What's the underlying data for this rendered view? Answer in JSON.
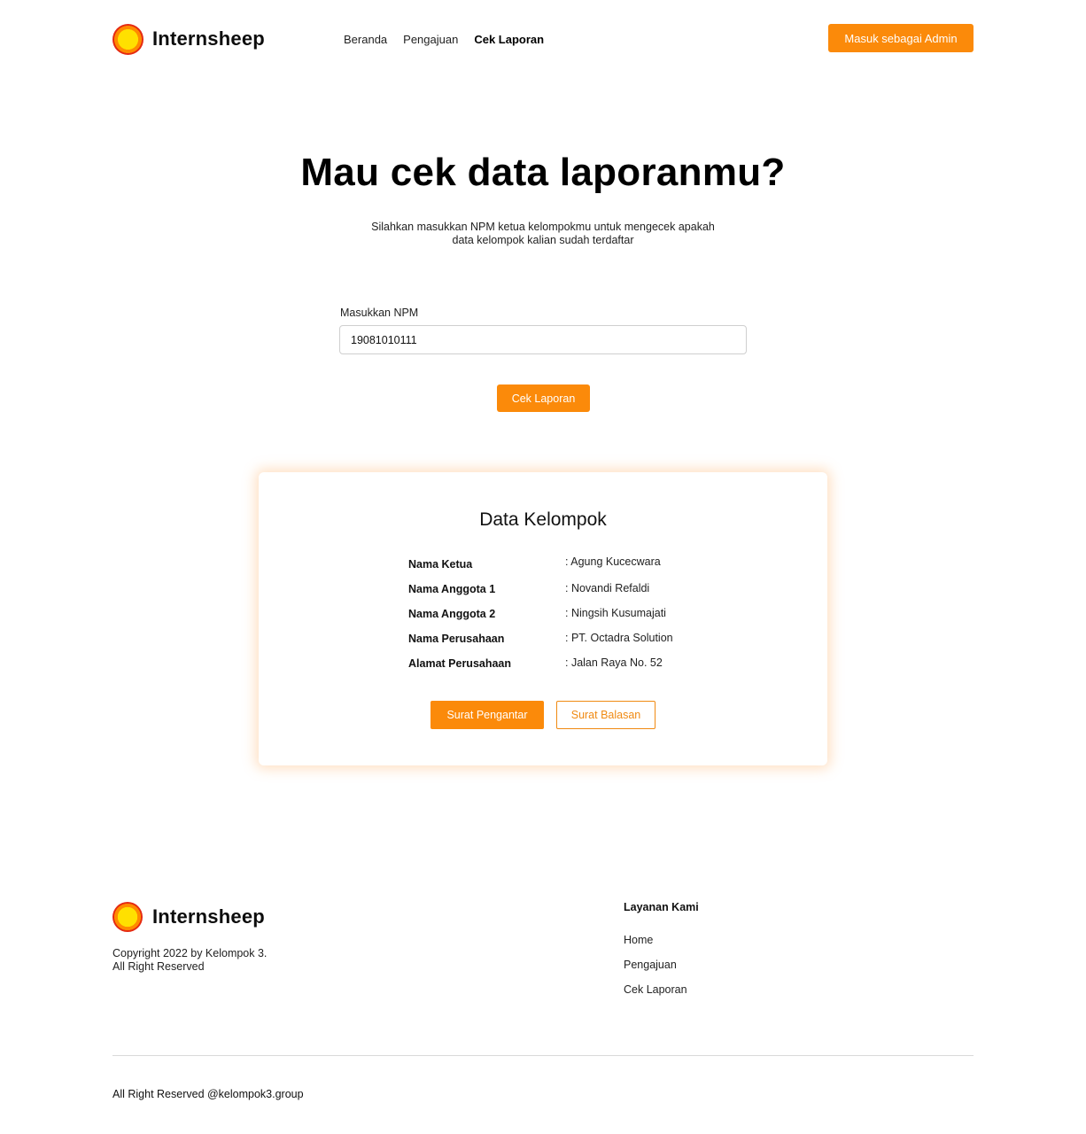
{
  "header": {
    "brand": "Internsheep",
    "nav": [
      "Beranda",
      "Pengajuan",
      "Cek Laporan"
    ],
    "active_nav": "Cek Laporan",
    "admin_button": "Masuk sebagai Admin"
  },
  "hero": {
    "title": "Mau cek data laporanmu?",
    "subtitle_line1": "Silahkan masukkan NPM ketua kelompokmu untuk mengecek apakah",
    "subtitle_line2": "data kelompok kalian sudah terdaftar"
  },
  "form": {
    "label": "Masukkan NPM",
    "value": "19081010111",
    "submit": "Cek Laporan"
  },
  "card": {
    "title": "Data Kelompok",
    "rows": [
      {
        "key": "Nama Ketua",
        "value": "Agung Kucecwara"
      },
      {
        "key": "Nama Anggota 1",
        "value": "Novandi Refaldi"
      },
      {
        "key": "Nama Anggota 2",
        "value": "Ningsih Kusumajati"
      },
      {
        "key": "Nama Perusahaan",
        "value": "PT. Octadra Solution"
      },
      {
        "key": "Alamat Perusahaan",
        "value": "Jalan Raya No. 52"
      }
    ],
    "primary_button": "Surat Pengantar",
    "secondary_button": "Surat Balasan"
  },
  "footer": {
    "brand": "Internsheep",
    "copyright_line1": "Copyright 2022 by Kelompok 3.",
    "copyright_line2": "All Right Reserved",
    "services_title": "Layanan Kami",
    "links": [
      "Home",
      "Pengajuan",
      "Cek Laporan"
    ],
    "bottom": "All Right Reserved @kelompok3.group"
  },
  "colors": {
    "accent": "#fb8a0a",
    "logo_outer": "#e52a12",
    "logo_inner": "#ffe000"
  }
}
